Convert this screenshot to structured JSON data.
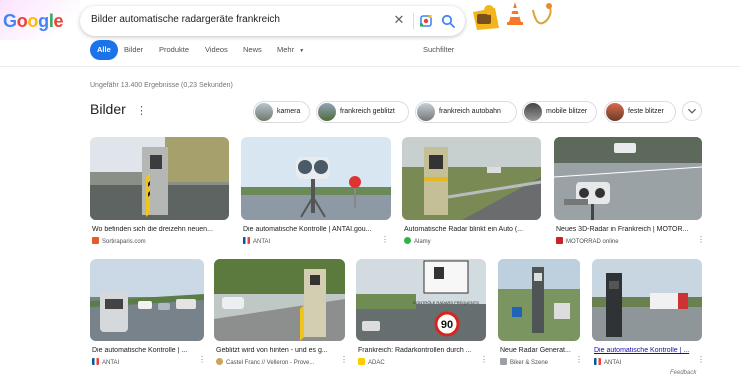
{
  "logo": {
    "text": "Google"
  },
  "search": {
    "query": "Bilder automatische radargeräte frankreich",
    "clear_icon": "close-icon",
    "lens_icon": "camera-lens-icon",
    "search_icon": "search-icon"
  },
  "tabs": [
    {
      "label": "Alle",
      "active": true
    },
    {
      "label": "Bilder"
    },
    {
      "label": "Produkte"
    },
    {
      "label": "Videos"
    },
    {
      "label": "News"
    },
    {
      "label": "Mehr"
    }
  ],
  "tools_label": "Suchfilter",
  "result_stats": "Ungefähr 13.400 Ergebnisse (0,23 Sekunden)",
  "images_heading": "Bilder",
  "chips": [
    {
      "label": "kamera"
    },
    {
      "label": "frankreich geblitzt"
    },
    {
      "label": "frankreich autobahn"
    },
    {
      "label": "mobile blitzer"
    },
    {
      "label": "feste blitzer"
    }
  ],
  "images_row1": [
    {
      "title": "Wo befinden sich die dreizehn neuen...",
      "source": "Sortiraparis.com"
    },
    {
      "title": "Die automatische Kontrolle | ANTAI.gou...",
      "source": "ANTAI"
    },
    {
      "title": "Automatische Radar blinkt ein Auto (...",
      "source": "Alamy"
    },
    {
      "title": "Neues 3D-Radar in Frankreich | MOTOR...",
      "source": "MOTORRAD online"
    }
  ],
  "images_row2": [
    {
      "title": "Die automatische Kontrolle | ...",
      "source": "ANTAI"
    },
    {
      "title": "Geblitzt wird von hinten - und es g...",
      "source": "Castel Franc // Velleron - Prove..."
    },
    {
      "title": "Frankreich: Radarkontrollen durch ...",
      "source": "ADAC"
    },
    {
      "title": "Neue Radar Generat...",
      "source": "Biker & Szene"
    },
    {
      "title": "Die automatische Kontrolle | ...",
      "source": "ANTAI"
    }
  ],
  "sign_text": {
    "plate": "CONTRÔLE RADARS FRÉQUENTS",
    "speed": "90"
  },
  "feedback": "Feedback",
  "colors": {
    "accent": "#1a73e8",
    "link": "#1a0dab"
  }
}
